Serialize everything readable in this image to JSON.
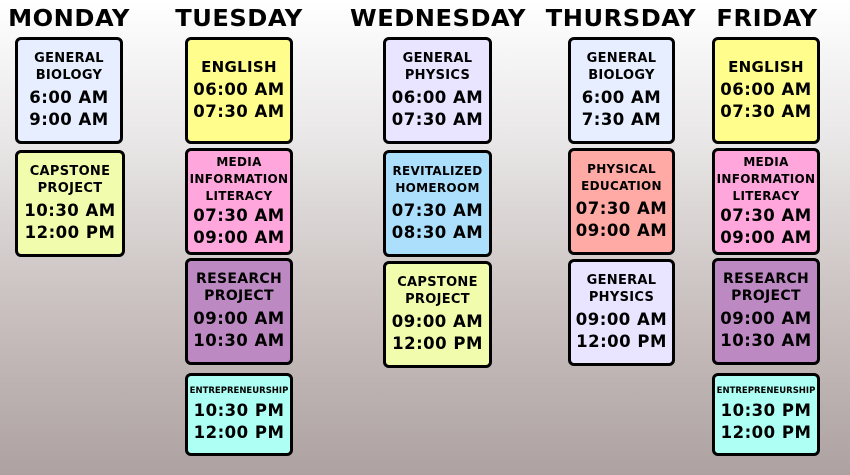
{
  "days": [
    {
      "name": "MONDAY",
      "classes": [
        {
          "subject": "GENERAL BIOLOGY",
          "start": "6:00 AM",
          "end": "9:00 AM",
          "color": "#e6eeff"
        },
        {
          "subject": "CAPSTONE PROJECT",
          "start": "10:30 AM",
          "end": "12:00 PM",
          "color": "#f2fcad"
        }
      ]
    },
    {
      "name": "TUESDAY",
      "classes": [
        {
          "subject": "ENGLISH",
          "start": "06:00 AM",
          "end": "07:30 AM",
          "color": "#fffd8c"
        },
        {
          "subject": "MEDIA INFORMATION LITERACY",
          "start": "07:30 AM",
          "end": "09:00 AM",
          "color": "#ffa6dc"
        },
        {
          "subject": "RESEARCH PROJECT",
          "start": "09:00 AM",
          "end": "10:30 AM",
          "color": "#bd89c2"
        },
        {
          "subject": "ENTREPRENEURSHIP",
          "start": "10:30 PM",
          "end": "12:00 PM",
          "color": "#aefff4"
        }
      ]
    },
    {
      "name": "WEDNESDAY",
      "classes": [
        {
          "subject": "GENERAL PHYSICS",
          "start": "06:00 AM",
          "end": "07:30 AM",
          "color": "#e9e4ff"
        },
        {
          "subject": "REVITALIZED HOMEROOM",
          "start": "07:30 AM",
          "end": "08:30 AM",
          "color": "#acdffb"
        },
        {
          "subject": "CAPSTONE PROJECT",
          "start": "09:00 AM",
          "end": "12:00 PM",
          "color": "#f2fcad"
        }
      ]
    },
    {
      "name": "THURSDAY",
      "classes": [
        {
          "subject": "GENERAL BIOLOGY",
          "start": "6:00 AM",
          "end": "7:30 AM",
          "color": "#e6eeff"
        },
        {
          "subject": "PHYSICAL EDUCATION",
          "start": "07:30 AM",
          "end": "09:00 AM",
          "color": "#ffaaa4"
        },
        {
          "subject": "GENERAL PHYSICS",
          "start": "09:00 AM",
          "end": "12:00 PM",
          "color": "#e9e4ff"
        }
      ]
    },
    {
      "name": "FRIDAY",
      "classes": [
        {
          "subject": "ENGLISH",
          "start": "06:00 AM",
          "end": "07:30 AM",
          "color": "#fffd8c"
        },
        {
          "subject": "MEDIA INFORMATION LITERACY",
          "start": "07:30 AM",
          "end": "09:00 AM",
          "color": "#ffa6dc"
        },
        {
          "subject": "RESEARCH PROJECT",
          "start": "09:00 AM",
          "end": "10:30 AM",
          "color": "#bd89c2"
        },
        {
          "subject": "ENTREPRENEURSHIP",
          "start": "10:30 PM",
          "end": "12:00 PM",
          "color": "#aefff4"
        }
      ]
    }
  ]
}
